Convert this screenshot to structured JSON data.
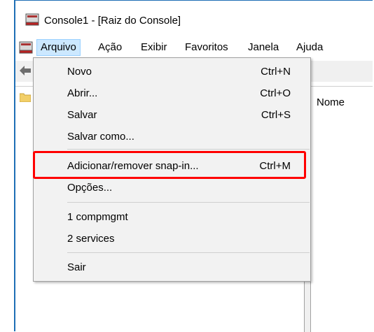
{
  "window": {
    "title": "Console1 - [Raiz do Console]"
  },
  "menubar": {
    "items": [
      "Arquivo",
      "Ação",
      "Exibir",
      "Favoritos",
      "Janela",
      "Ajuda"
    ],
    "active": "Arquivo"
  },
  "content": {
    "column_header": "Nome"
  },
  "file_menu": {
    "items": [
      {
        "label": "Novo",
        "shortcut": "Ctrl+N"
      },
      {
        "label": "Abrir...",
        "shortcut": "Ctrl+O"
      },
      {
        "label": "Salvar",
        "shortcut": "Ctrl+S"
      },
      {
        "label": "Salvar como...",
        "shortcut": ""
      },
      {
        "label": "Adicionar/remover snap-in...",
        "shortcut": "Ctrl+M"
      },
      {
        "label": "Opções...",
        "shortcut": ""
      },
      {
        "label": "1 compmgmt",
        "shortcut": ""
      },
      {
        "label": "2 services",
        "shortcut": ""
      },
      {
        "label": "Sair",
        "shortcut": ""
      }
    ]
  },
  "colors": {
    "highlight_border": "#ff0000",
    "menu_active_bg": "#cce8ff",
    "menu_bg": "#f2f2f2"
  },
  "icons": {
    "app": "mmc-console-icon",
    "menu_app": "mmc-system-menu-icon",
    "back": "back-arrow-icon",
    "folder": "folder-icon"
  }
}
